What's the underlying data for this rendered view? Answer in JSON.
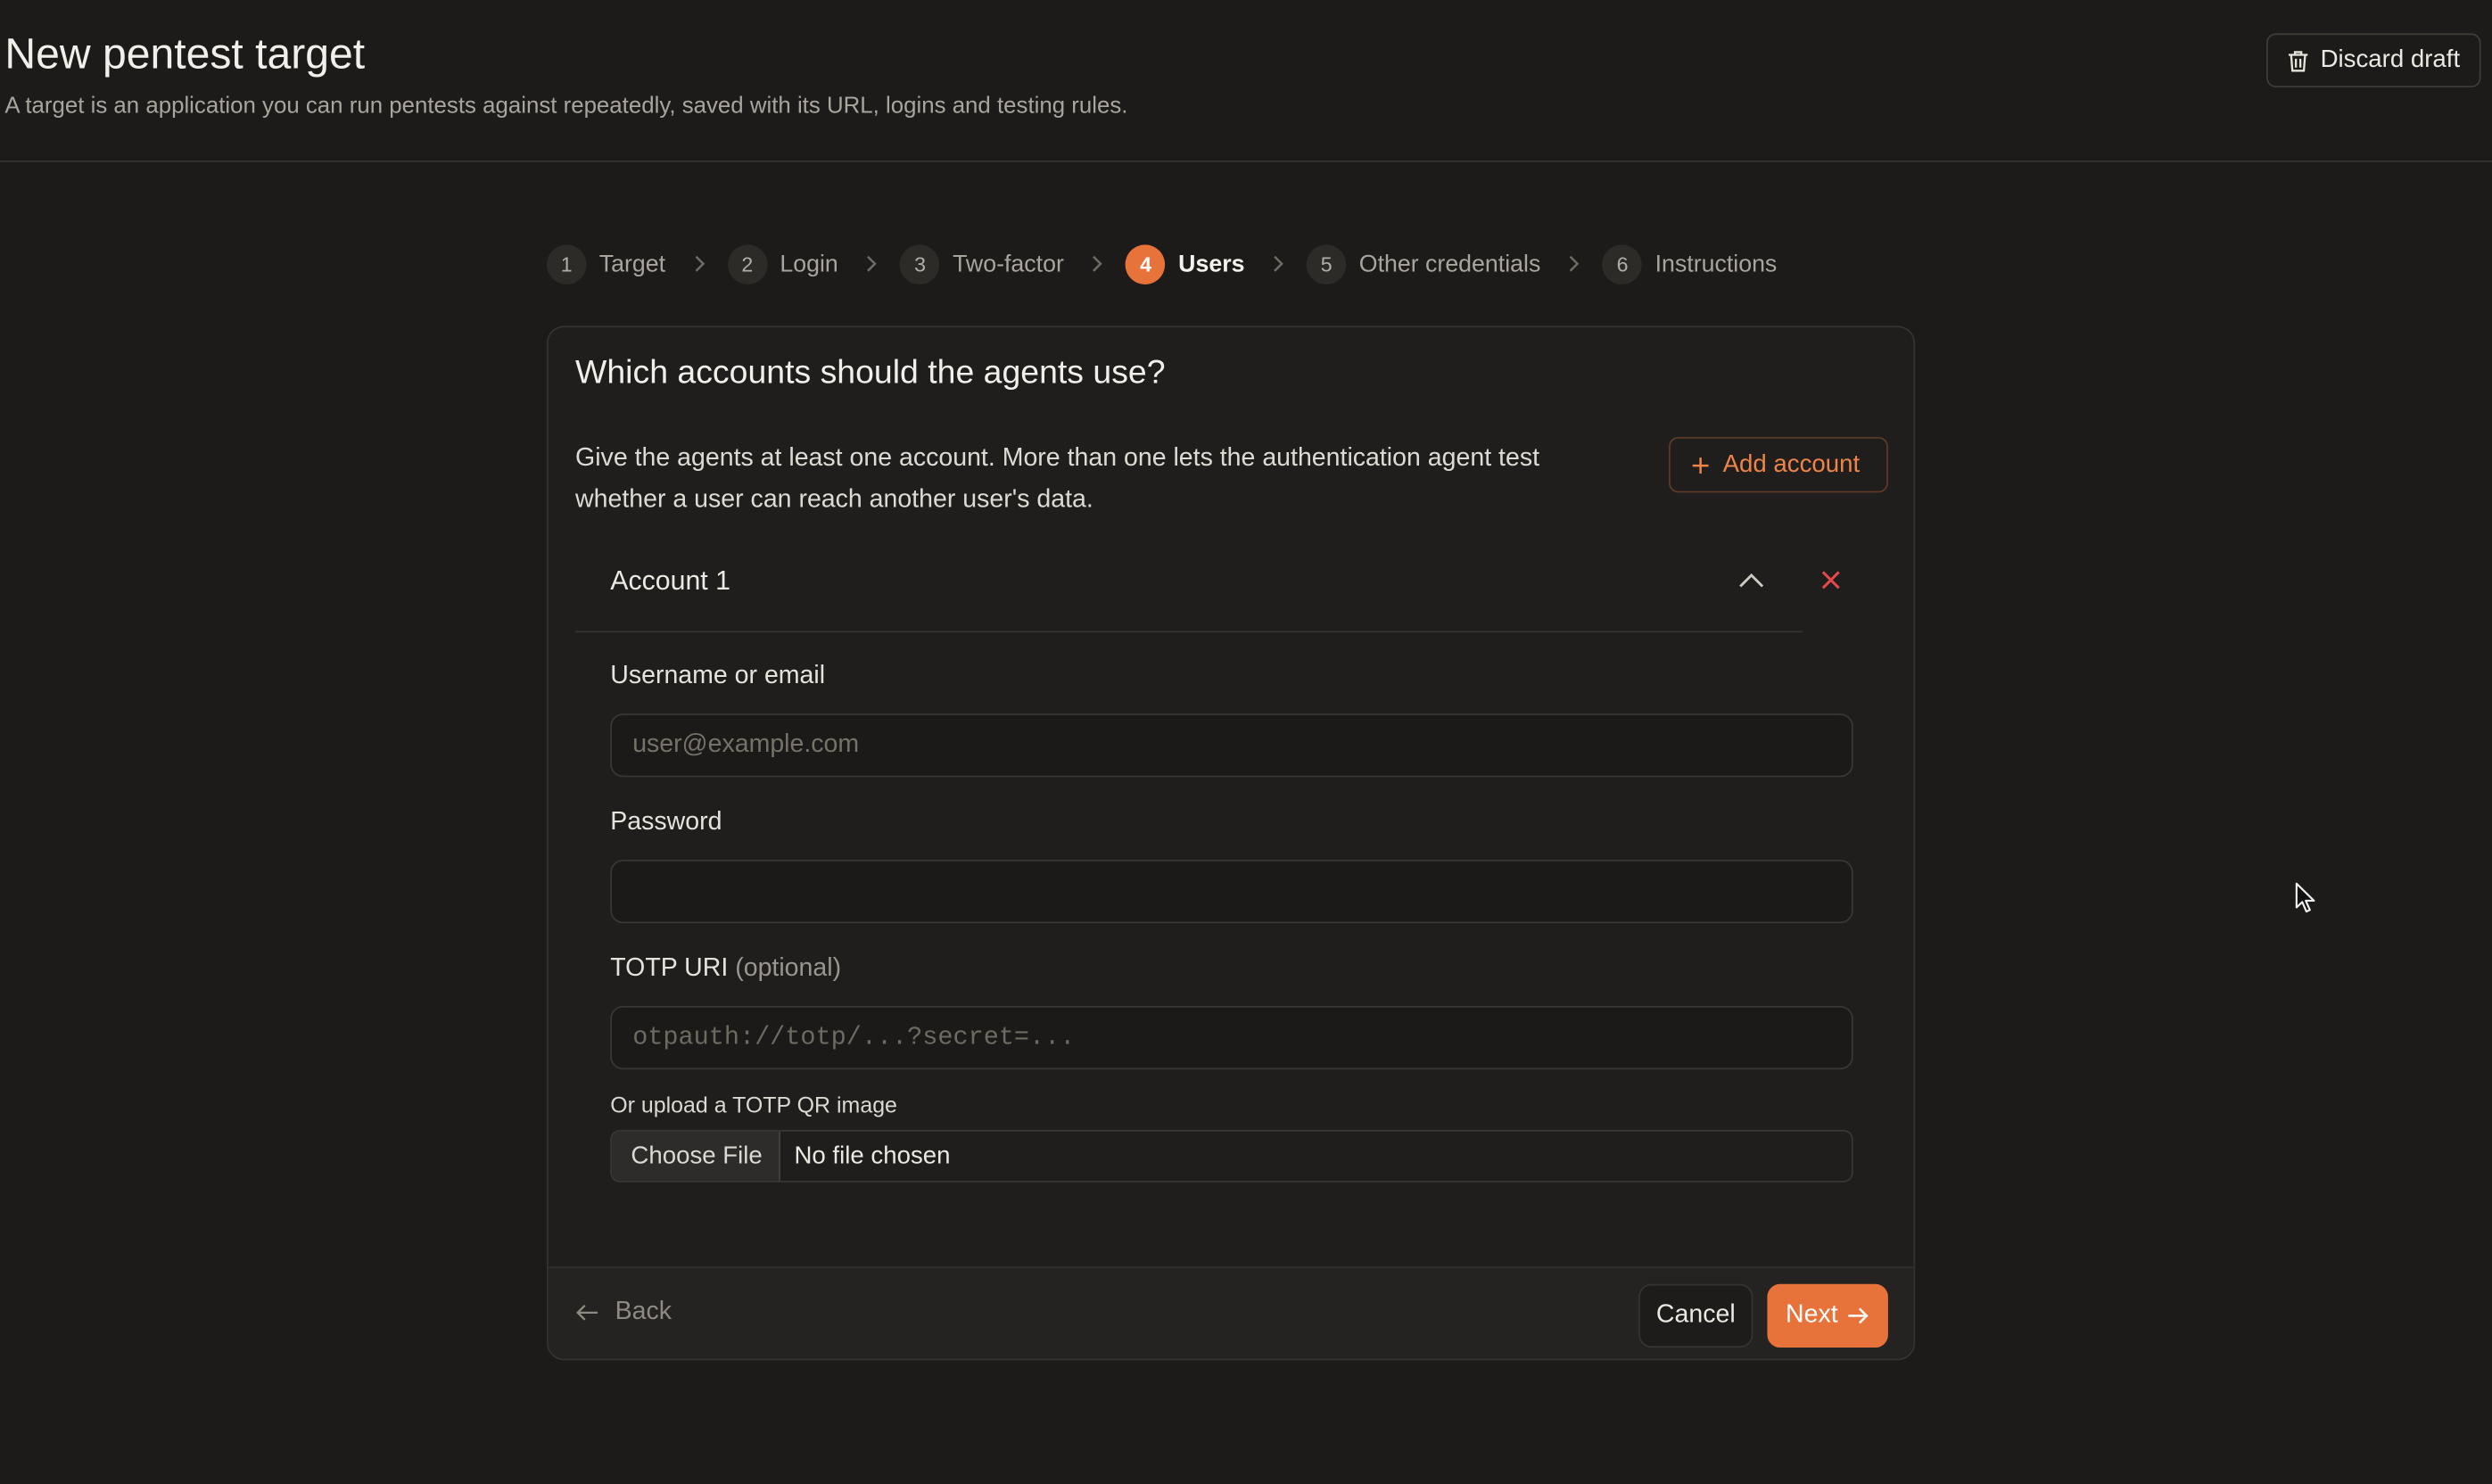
{
  "header": {
    "title": "New pentest target",
    "subtitle": "A target is an application you can run pentests against repeatedly, saved with its URL, logins and testing rules.",
    "discard_label": "Discard draft"
  },
  "stepper": {
    "steps": [
      {
        "num": "1",
        "label": "Target"
      },
      {
        "num": "2",
        "label": "Login"
      },
      {
        "num": "3",
        "label": "Two-factor"
      },
      {
        "num": "4",
        "label": "Users",
        "active": true
      },
      {
        "num": "5",
        "label": "Other credentials"
      },
      {
        "num": "6",
        "label": "Instructions"
      }
    ]
  },
  "card": {
    "title": "Which accounts should the agents use?",
    "description": "Give the agents at least one account. More than one lets the authentication agent test whether a user can reach another user's data.",
    "add_account_label": "Add account",
    "account": {
      "title": "Account 1",
      "username_label": "Username or email",
      "username_placeholder": "user@example.com",
      "username_value": "",
      "password_label": "Password",
      "password_value": "",
      "totp_label": "TOTP URI",
      "totp_optional": "(optional)",
      "totp_placeholder": "otpauth://totp/...?secret=...",
      "totp_value": "",
      "qr_label": "Or upload a TOTP QR image",
      "file_button": "Choose File",
      "file_status": "No file chosen"
    }
  },
  "footer": {
    "back_label": "Back",
    "cancel_label": "Cancel",
    "next_label": "Next"
  },
  "colors": {
    "background": "#1c1b19",
    "card": "#1f1e1c",
    "accent": "#e8733a",
    "danger": "#e5484d"
  }
}
